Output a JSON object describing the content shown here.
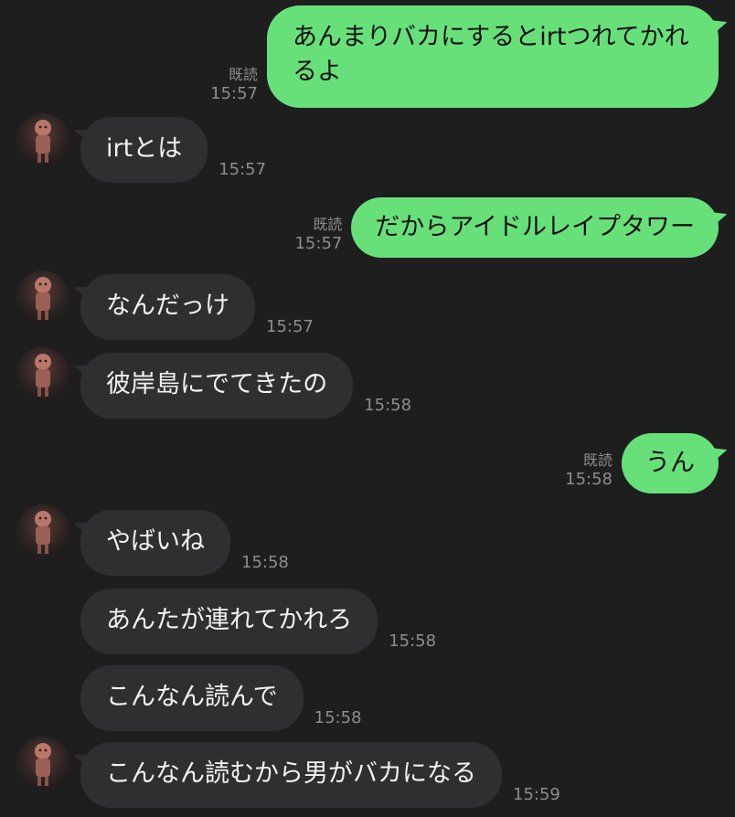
{
  "messages": [
    {
      "side": "out",
      "text": "あんまりバカにするとirtつれてかれるよ",
      "read": "既読",
      "time": "15:57"
    },
    {
      "side": "in",
      "text": "irtとは",
      "time": "15:57"
    },
    {
      "side": "out",
      "text": "だからアイドルレイプタワー",
      "read": "既読",
      "time": "15:57"
    },
    {
      "side": "in",
      "text": "なんだっけ",
      "time": "15:57"
    },
    {
      "side": "in",
      "text": "彼岸島にでてきたの",
      "time": "15:58"
    },
    {
      "side": "out",
      "text": "うん",
      "read": "既読",
      "time": "15:58"
    },
    {
      "side": "in",
      "text": "やばいね",
      "time": "15:58"
    },
    {
      "side": "in",
      "text": "あんたが連れてかれろ",
      "time": "15:58"
    },
    {
      "side": "in",
      "text": "こんなん読んで",
      "time": "15:58"
    },
    {
      "side": "in",
      "text": "こんなん読むから男がバカになる",
      "time": "15:59"
    }
  ],
  "colors": {
    "background": "#1e1e1f",
    "outgoing_bubble": "#67e07a",
    "incoming_bubble": "#2f2f31",
    "meta_text": "#8d8d8d"
  }
}
